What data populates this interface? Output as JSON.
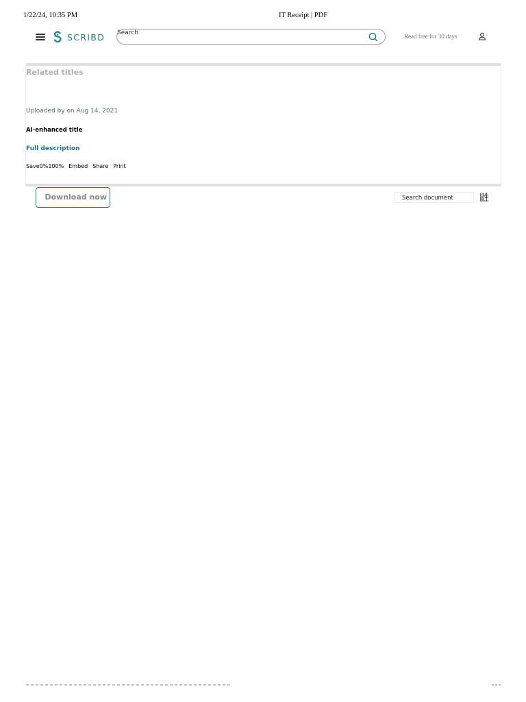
{
  "print_header": {
    "datetime": "1/22/24, 10:35 PM",
    "title": "IT Receipt | PDF"
  },
  "nav": {
    "brand": "SCRIBD",
    "search_placeholder": "Search",
    "read_free": "Read free for 30 days"
  },
  "panel": {
    "related_titles": "Related titles",
    "uploaded_by": "Uploaded by on Aug 14, 2021",
    "ai_title": "AI-enhanced title",
    "full_description": "Full description",
    "actions": {
      "save": "Save",
      "rating_up": "0%",
      "rating_down": "100%",
      "embed": "Embed",
      "share": "Share",
      "print": "Print"
    }
  },
  "toolbar": {
    "download_label": "Download now",
    "doc_search_placeholder": "Search document",
    "doc_search_glyph": "鼪"
  },
  "colors": {
    "brand_teal": "#1e7b85",
    "border_gray": "#e0e0e0",
    "muted_text": "#b0b0b0"
  }
}
